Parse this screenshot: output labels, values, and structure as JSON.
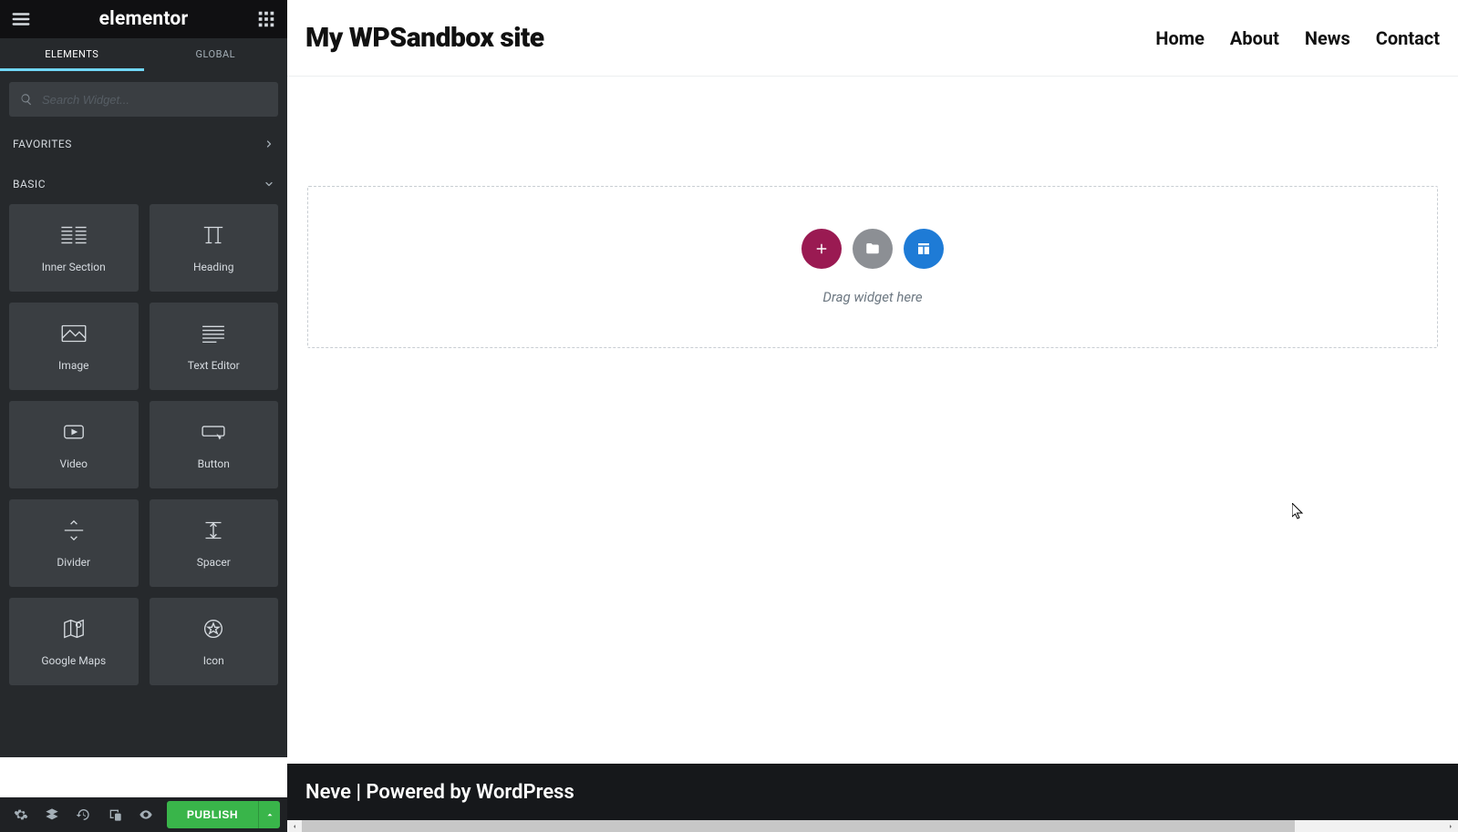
{
  "panel": {
    "brand": "elementor",
    "tabs": {
      "elements": "ELEMENTS",
      "global": "GLOBAL",
      "active": "elements"
    },
    "search_placeholder": "Search Widget...",
    "categories": {
      "favorites": "FAVORITES",
      "basic": "BASIC"
    },
    "widgets": [
      {
        "id": "inner-section",
        "label": "Inner Section"
      },
      {
        "id": "heading",
        "label": "Heading"
      },
      {
        "id": "image",
        "label": "Image"
      },
      {
        "id": "text-editor",
        "label": "Text Editor"
      },
      {
        "id": "video",
        "label": "Video"
      },
      {
        "id": "button",
        "label": "Button"
      },
      {
        "id": "divider",
        "label": "Divider"
      },
      {
        "id": "spacer",
        "label": "Spacer"
      },
      {
        "id": "google-maps",
        "label": "Google Maps"
      },
      {
        "id": "icon",
        "label": "Icon"
      }
    ],
    "footer": {
      "publish": "PUBLISH"
    }
  },
  "preview": {
    "site_title": "My WPSandbox site",
    "nav": [
      "Home",
      "About",
      "News",
      "Contact"
    ],
    "dropzone_text": "Drag widget here",
    "footer_text": "Neve | Powered by WordPress"
  }
}
